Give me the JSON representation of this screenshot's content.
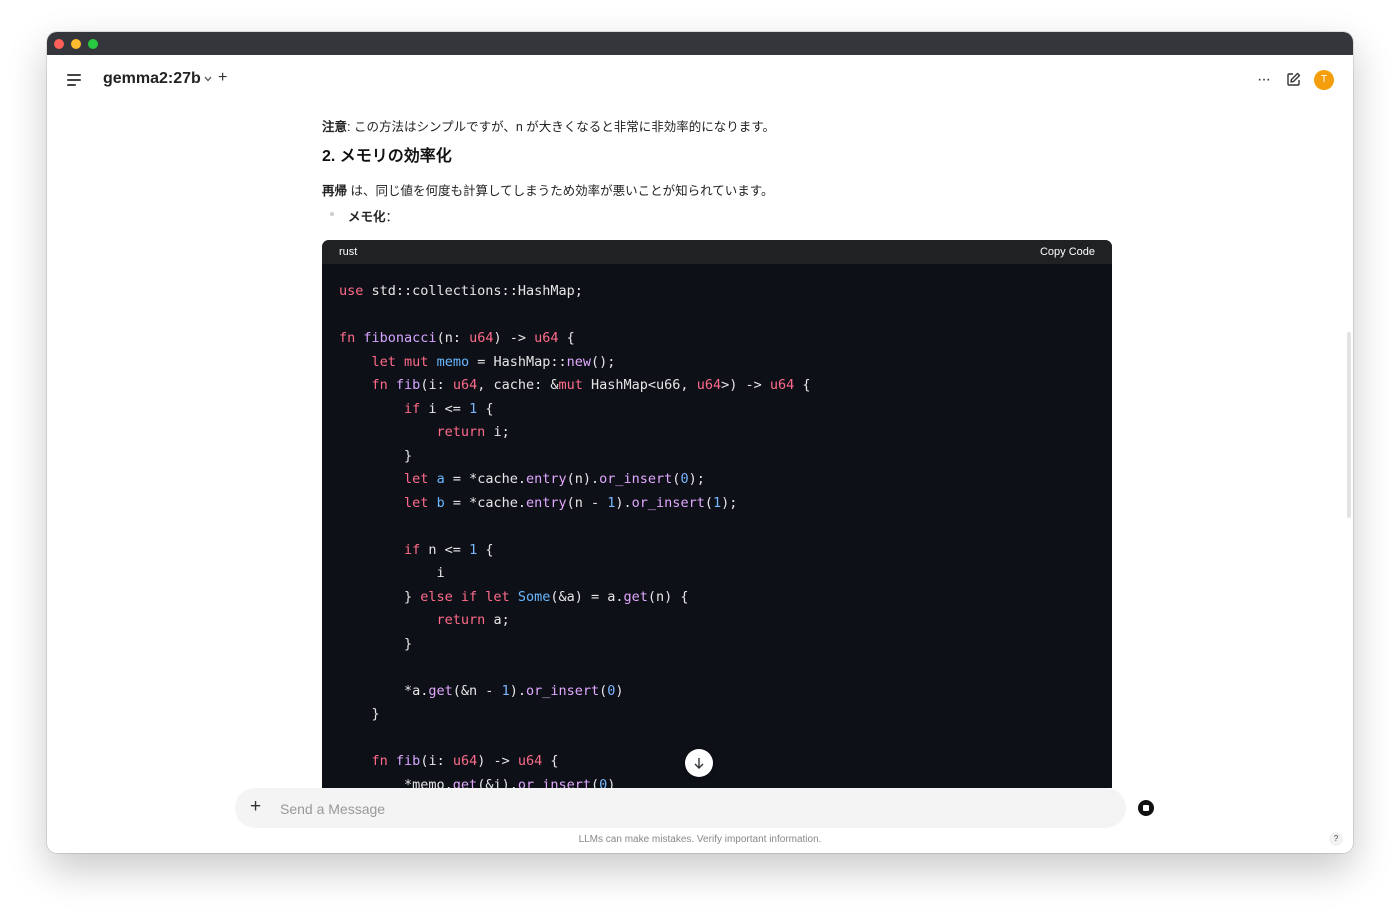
{
  "header": {
    "model_name": "gemma2:27b",
    "new_chat_symbol": "+",
    "more_symbol": "···",
    "avatar_initial": "T"
  },
  "message": {
    "note_label": "注意",
    "note_text": ": この方法はシンプルですが、n が大きくなると非常に非効率的になります。",
    "heading": "2. メモリの効率化",
    "recursion_label": "再帰",
    "recursion_text": " は、同じ値を何度も計算してしまうため効率が悪いことが知られています。",
    "bullet_label": "メモ化",
    "bullet_suffix": "："
  },
  "code_block": {
    "language": "rust",
    "copy_label": "Copy Code",
    "lines": [
      [
        [
          "kw",
          "use"
        ],
        [
          "plain",
          " std::collections::HashMap;"
        ]
      ],
      [],
      [
        [
          "kw",
          "fn"
        ],
        [
          "plain",
          " "
        ],
        [
          "fn",
          "fibonacci"
        ],
        [
          "plain",
          "(n: "
        ],
        [
          "ty",
          "u64"
        ],
        [
          "plain",
          ") -> "
        ],
        [
          "ty",
          "u64"
        ],
        [
          "plain",
          " {"
        ]
      ],
      [
        [
          "plain",
          "    "
        ],
        [
          "kw",
          "let mut"
        ],
        [
          "plain",
          " "
        ],
        [
          "var",
          "memo"
        ],
        [
          "plain",
          " = HashMap::"
        ],
        [
          "fnc",
          "new"
        ],
        [
          "plain",
          "();"
        ]
      ],
      [
        [
          "plain",
          "    "
        ],
        [
          "kw",
          "fn"
        ],
        [
          "plain",
          " "
        ],
        [
          "fn",
          "fib"
        ],
        [
          "plain",
          "(i: "
        ],
        [
          "ty",
          "u64"
        ],
        [
          "plain",
          ", cache: &"
        ],
        [
          "kw",
          "mut"
        ],
        [
          "plain",
          " HashMap<u66, "
        ],
        [
          "ty",
          "u64"
        ],
        [
          "plain",
          ">) -> "
        ],
        [
          "ty",
          "u64"
        ],
        [
          "plain",
          " {"
        ]
      ],
      [
        [
          "plain",
          "        "
        ],
        [
          "kw",
          "if"
        ],
        [
          "plain",
          " i <= "
        ],
        [
          "num",
          "1"
        ],
        [
          "plain",
          " {"
        ]
      ],
      [
        [
          "plain",
          "            "
        ],
        [
          "kw",
          "return"
        ],
        [
          "plain",
          " i;"
        ]
      ],
      [
        [
          "plain",
          "        }"
        ]
      ],
      [
        [
          "plain",
          "        "
        ],
        [
          "kw",
          "let"
        ],
        [
          "plain",
          " "
        ],
        [
          "var",
          "a"
        ],
        [
          "plain",
          " = *cache."
        ],
        [
          "fnc",
          "entry"
        ],
        [
          "plain",
          "(n)."
        ],
        [
          "fnc",
          "or_insert"
        ],
        [
          "plain",
          "("
        ],
        [
          "num",
          "0"
        ],
        [
          "plain",
          ");"
        ]
      ],
      [
        [
          "plain",
          "        "
        ],
        [
          "kw",
          "let"
        ],
        [
          "plain",
          " "
        ],
        [
          "var",
          "b"
        ],
        [
          "plain",
          " = *cache."
        ],
        [
          "fnc",
          "entry"
        ],
        [
          "plain",
          "(n - "
        ],
        [
          "num",
          "1"
        ],
        [
          "plain",
          ")."
        ],
        [
          "fnc",
          "or_insert"
        ],
        [
          "plain",
          "("
        ],
        [
          "num",
          "1"
        ],
        [
          "plain",
          ");"
        ]
      ],
      [],
      [
        [
          "plain",
          "        "
        ],
        [
          "kw",
          "if"
        ],
        [
          "plain",
          " n <= "
        ],
        [
          "num",
          "1"
        ],
        [
          "plain",
          " {"
        ]
      ],
      [
        [
          "plain",
          "            i"
        ]
      ],
      [
        [
          "plain",
          "        } "
        ],
        [
          "kw",
          "else if let"
        ],
        [
          "plain",
          " "
        ],
        [
          "var",
          "Some"
        ],
        [
          "plain",
          "(&a) = a."
        ],
        [
          "fnc",
          "get"
        ],
        [
          "plain",
          "(n) {"
        ]
      ],
      [
        [
          "plain",
          "            "
        ],
        [
          "kw",
          "return"
        ],
        [
          "plain",
          " a;"
        ]
      ],
      [
        [
          "plain",
          "        }"
        ]
      ],
      [],
      [
        [
          "plain",
          "        *a."
        ],
        [
          "fnc",
          "get"
        ],
        [
          "plain",
          "(&n - "
        ],
        [
          "num",
          "1"
        ],
        [
          "plain",
          ")."
        ],
        [
          "fnc",
          "or_insert"
        ],
        [
          "plain",
          "("
        ],
        [
          "num",
          "0"
        ],
        [
          "plain",
          ")"
        ]
      ],
      [
        [
          "plain",
          "    }"
        ]
      ],
      [],
      [
        [
          "plain",
          "    "
        ],
        [
          "kw",
          "fn"
        ],
        [
          "plain",
          " "
        ],
        [
          "fn",
          "fib"
        ],
        [
          "plain",
          "(i: "
        ],
        [
          "ty",
          "u64"
        ],
        [
          "plain",
          ") -> "
        ],
        [
          "ty",
          "u64"
        ],
        [
          "plain",
          " {"
        ]
      ],
      [
        [
          "plain",
          "        *memo."
        ],
        [
          "fnc",
          "get"
        ],
        [
          "plain",
          "(&i)."
        ],
        [
          "fnc",
          "or_insert"
        ],
        [
          "plain",
          "("
        ],
        [
          "num",
          "0"
        ],
        [
          "plain",
          ")"
        ]
      ]
    ]
  },
  "input": {
    "plus_symbol": "+",
    "placeholder": "Send a Message",
    "value": ""
  },
  "footer": {
    "disclaimer": "LLMs can make mistakes. Verify important information.",
    "help_symbol": "?"
  },
  "colors": {
    "titlebar": "#35363c",
    "code_bg": "#0d1017",
    "code_header": "#202123",
    "keyword": "#ff6b8a",
    "function": "#d6a6ff",
    "variable": "#69b8ff",
    "avatar": "#f59e0b"
  }
}
